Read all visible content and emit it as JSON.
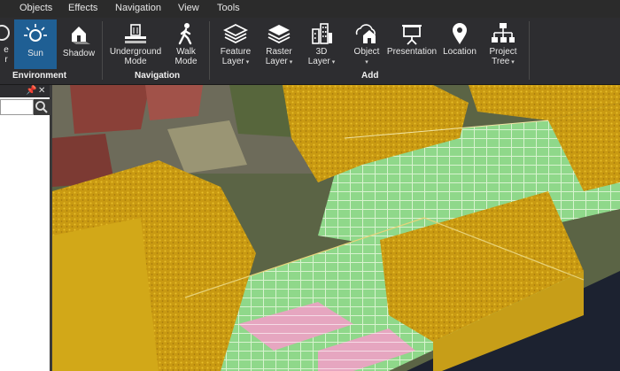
{
  "menu": [
    "Objects",
    "Effects",
    "Navigation",
    "View",
    "Tools"
  ],
  "ribbon": {
    "environment": {
      "partial_label_top": "e",
      "partial_label_bottom": "r",
      "sun": "Sun",
      "shadow": "Shadow",
      "group": "Environment"
    },
    "navigation": {
      "underground": [
        "Underground",
        "Mode"
      ],
      "walk": [
        "Walk",
        "Mode"
      ],
      "group": "Navigation"
    },
    "add": {
      "feature_layer": [
        "Feature",
        "Layer"
      ],
      "raster_layer": [
        "Raster",
        "Layer"
      ],
      "layer_3d": [
        "3D",
        "Layer"
      ],
      "object": "Object",
      "presentation": "Presentation",
      "location": "Location",
      "project_tree": [
        "Project",
        "Tree"
      ],
      "group": "Add"
    }
  },
  "panel": {
    "pin_glyph": "📌",
    "close_glyph": "✕",
    "search_placeholder": ""
  },
  "colors": {
    "ribbon_bg": "#2d2d30",
    "active_button": "#1f5f94",
    "point_cloud_yellow": "#d4a615"
  }
}
